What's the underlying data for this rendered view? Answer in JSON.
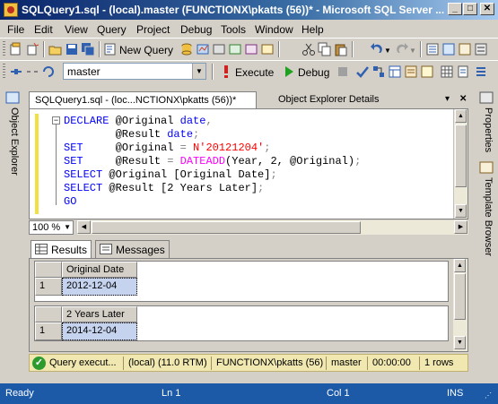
{
  "window": {
    "title": "SQLQuery1.sql - (local).master (FUNCTIONX\\pkatts (56))* - Microsoft SQL Server ...",
    "minimize": "_",
    "maximize": "□",
    "close": "✕"
  },
  "menu": [
    "File",
    "Edit",
    "View",
    "Query",
    "Project",
    "Debug",
    "Tools",
    "Window",
    "Help"
  ],
  "toolbar1": {
    "new_query_label": "New Query"
  },
  "toolbar2": {
    "database": "master",
    "execute_label": "Execute",
    "debug_label": "Debug"
  },
  "side_left": {
    "object_explorer": "Object Explorer"
  },
  "side_right": {
    "properties": "Properties",
    "template_browser": "Template Browser"
  },
  "doc_tabs": {
    "active": "SQLQuery1.sql - (loc...NCTIONX\\pkatts (56))*",
    "active_close": "✕",
    "inactive": "Object Explorer Details"
  },
  "editor": {
    "lines": [
      {
        "kw": "DECLARE",
        "rest": " @Original ",
        "type": "date",
        "tail": ","
      },
      {
        "kw": "",
        "rest": "        @Result ",
        "type": "date",
        "tail": ";"
      },
      {
        "kw": "SET",
        "rest": "     @Original ",
        "op": "=",
        "str": " N'20121204'",
        "tail": ";"
      },
      {
        "kw": "SET",
        "rest": "     @Result ",
        "op": "=",
        "fn": " DATEADD",
        "args": "(Year, 2, @Original)",
        "tail": ";"
      },
      {
        "kw": "SELECT",
        "rest": " @Original [Original Date]",
        "tail": ";"
      },
      {
        "kw": "SELECT",
        "rest": " @Result [2 Years Later]",
        "tail": ";"
      },
      {
        "kw": "GO",
        "rest": "",
        "tail": ""
      }
    ],
    "zoom": "100 %"
  },
  "results": {
    "tabs": {
      "results": "Results",
      "messages": "Messages"
    },
    "grid1": {
      "header": "Original Date",
      "row_num": "1",
      "value": "2012-12-04"
    },
    "grid2": {
      "header": "2 Years Later",
      "row_num": "1",
      "value": "2014-12-04"
    }
  },
  "query_status": {
    "message": "Query execut...",
    "server": "(local) (11.0 RTM)",
    "user": "FUNCTIONX\\pkatts (56)",
    "database": "master",
    "elapsed": "00:00:00",
    "rows": "1 rows"
  },
  "statusbar": {
    "state": "Ready",
    "line": "Ln 1",
    "col": "Col 1",
    "mode": "INS"
  }
}
